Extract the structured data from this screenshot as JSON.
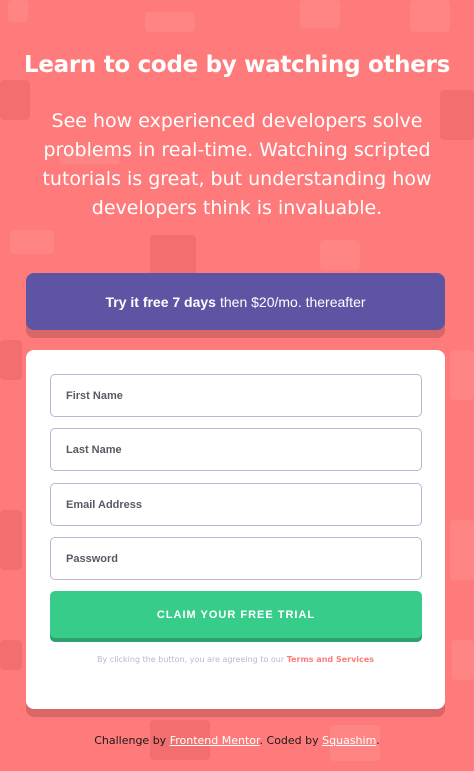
{
  "hero": {
    "title": "Learn to code by watching others",
    "description": "See how experienced developers solve problems in real-time. Watching scripted tutorials is great, but understanding how developers think is invaluable."
  },
  "banner": {
    "bold_text": "Try it free 7 days",
    "rest_text": "then $20/mo. thereafter"
  },
  "form": {
    "fields": [
      {
        "placeholder": "First Name"
      },
      {
        "placeholder": "Last Name"
      },
      {
        "placeholder": "Email Address"
      },
      {
        "placeholder": "Password"
      }
    ],
    "submit_label": "CLAIM YOUR FREE TRIAL",
    "terms_prefix": "By clicking the button, you are agreeing to our",
    "terms_link": "Terms and Services"
  },
  "footer": {
    "prefix": "Challenge by",
    "challenge_link": "Frontend Mentor",
    "middle": ". Coded by",
    "author_link": "Squashim",
    "suffix": "."
  },
  "colors": {
    "background": "#ff7a7a",
    "banner": "#5e54a4",
    "button": "#38cc8b",
    "terms_link": "#ff7a7a"
  }
}
